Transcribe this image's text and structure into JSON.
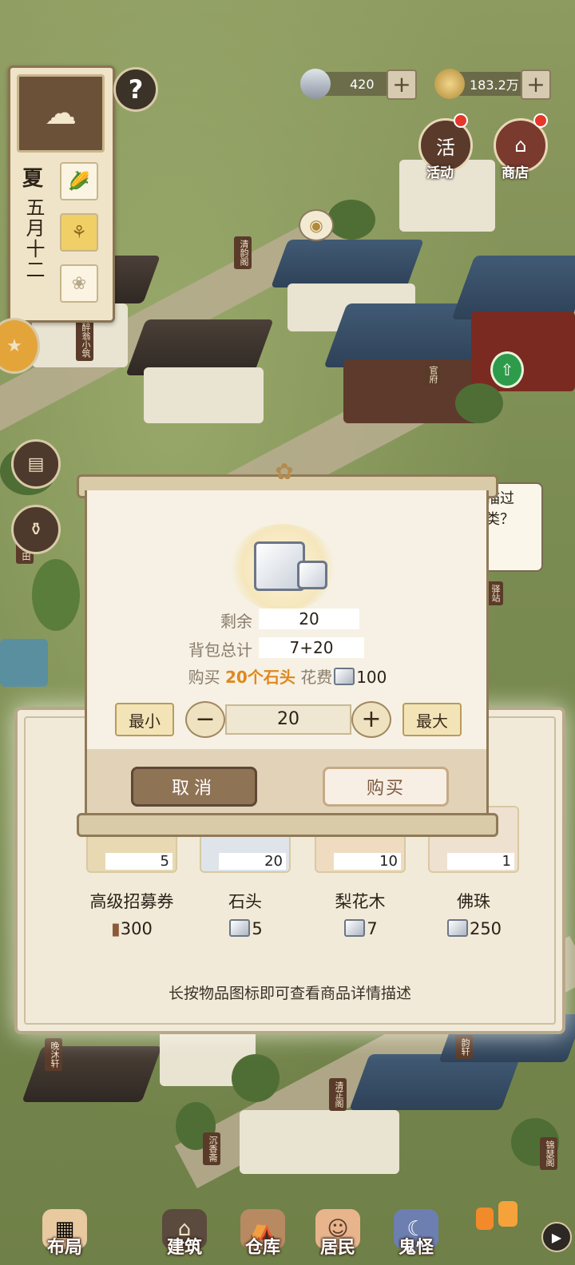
{
  "resources": {
    "silver": {
      "value": "420",
      "icon": "silver-ingot-icon"
    },
    "coins": {
      "value": "183.2万",
      "icon": "coin-icon"
    }
  },
  "side_panel": {
    "season": "夏",
    "date": "五月十二",
    "help": "?"
  },
  "top_right": {
    "activity_label": "活动",
    "activity_glyph": "活",
    "shop_label": "商店"
  },
  "map_signs": [
    "清韵阁",
    "醉翁小筑",
    "官府",
    "驿站",
    "水田",
    "晚沐轩",
    "清芷阁",
    "沉香斋",
    "锦瑟阁",
    "韵轩"
  ],
  "speech_bubble": "描过\n类？",
  "dialog": {
    "remaining_label": "剩余",
    "remaining_value": "20",
    "bag_total_label": "背包总计",
    "bag_total_value": "7+20",
    "buy_prefix": "购买",
    "buy_qty": "20个",
    "buy_item": "石头",
    "cost_label": "花费",
    "cost_value": "100",
    "min_label": "最小",
    "max_label": "最大",
    "quantity": "20",
    "minus": "−",
    "plus": "+",
    "cancel_label": "取消",
    "buy_label": "购买"
  },
  "shop": {
    "items": [
      {
        "name": "高级招募券",
        "qty": "5",
        "price": "300",
        "price_icon": "wood-log-icon"
      },
      {
        "name": "石头",
        "qty": "20",
        "price": "5",
        "price_icon": "stone-icon"
      },
      {
        "name": "梨花木",
        "qty": "10",
        "price": "7",
        "price_icon": "stone-icon"
      },
      {
        "name": "佛珠",
        "qty": "1",
        "price": "250",
        "price_icon": "stone-icon"
      }
    ],
    "hint": "长按物品图标即可查看商品详情描述"
  },
  "nav": {
    "layout": "布局",
    "build": "建筑",
    "warehouse": "仓库",
    "residents": "居民",
    "ghosts": "鬼怪"
  },
  "colors": {
    "accent_orange": "#e0881e",
    "panel_border": "#8f7a58"
  }
}
